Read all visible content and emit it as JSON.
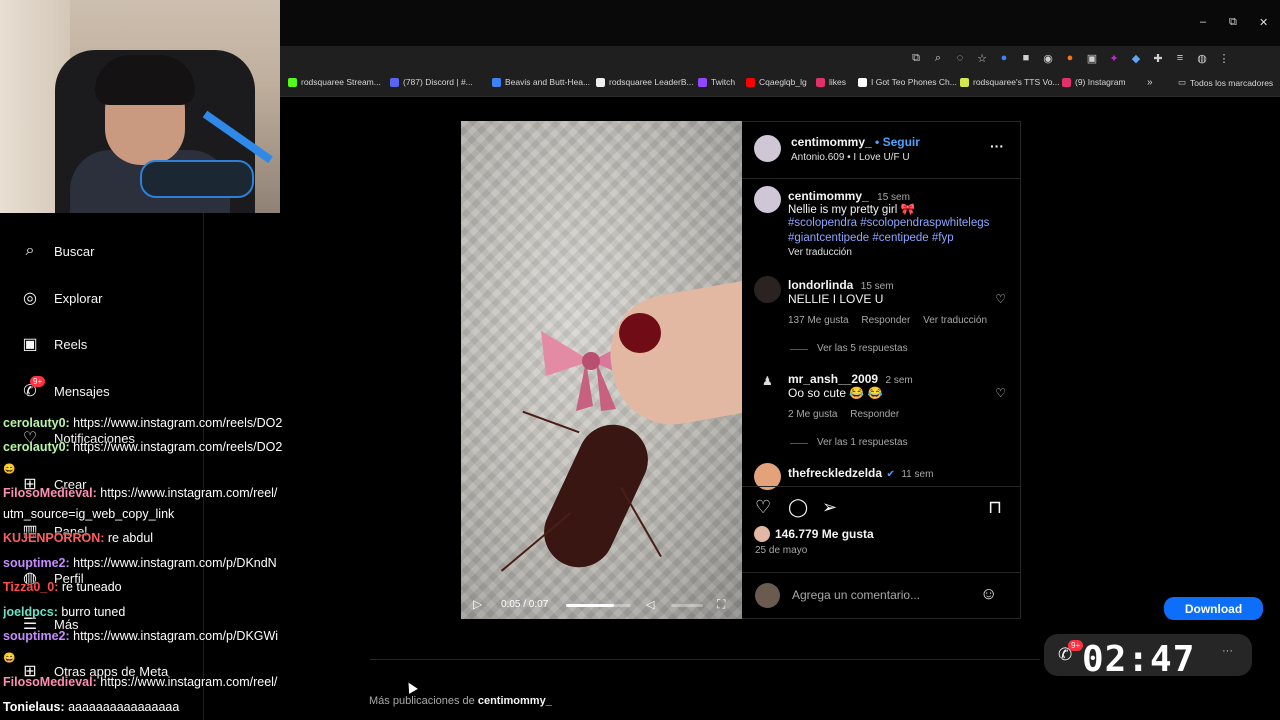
{
  "window": {
    "minimize": "–",
    "maximize": "⧉",
    "close": "✕"
  },
  "bookmarks": [
    {
      "label": "rodsquaree Stream...",
      "color": "#53fc18"
    },
    {
      "label": "(787) Discord | #...",
      "color": "#5865f2"
    },
    {
      "label": "Beavis and Butt-Hea...",
      "color": "#3b82f6"
    },
    {
      "label": "rodsquaree LeaderB...",
      "color": "#eeeeee"
    },
    {
      "label": "Twitch",
      "color": "#9146ff"
    },
    {
      "label": "Cqaeglqb_lg",
      "color": "#ff0000"
    },
    {
      "label": "likes",
      "color": "#e1306c"
    },
    {
      "label": "I Got Teo Phones Ch...",
      "color": "#ffffff"
    },
    {
      "label": "rodsquaree's TTS Vo...",
      "color": "#d7e84a"
    },
    {
      "label": "(9) Instagram",
      "color": "#e1306c"
    }
  ],
  "bookmarks_overflow": "»",
  "bookmarks_all": "Todos los marcadores",
  "nav": {
    "search": "Buscar",
    "explore": "Explorar",
    "reels": "Reels",
    "messages": "Mensajes",
    "messages_badge": "9+",
    "notifications": "Notificaciones",
    "create": "Crear",
    "panel": "Panel",
    "profile": "Perfil",
    "more": "Más",
    "meta": "Otras apps de Meta"
  },
  "chat": [
    {
      "user": "cerolauty0:",
      "msg": " https://www.instagram.com/reels/DO2",
      "color": "#b9f5a5"
    },
    {
      "user": "cerolauty0:",
      "msg": " https://www.instagram.com/reels/DO2",
      "color": "#b9f5a5"
    },
    {
      "user": "FilosoMedieval:",
      "msg": " https://www.instagram.com/reel/",
      "color": "#ff8fb1"
    },
    {
      "user": "",
      "msg": "utm_source=ig_web_copy_link",
      "color": "#ffffff"
    },
    {
      "user": "KUJENPORRON:",
      "msg": " re abdul",
      "color": "#ff5f5f"
    },
    {
      "user": "souptime2:",
      "msg": " https://www.instagram.com/p/DKndN",
      "color": "#c58cff"
    },
    {
      "user": "Tizza0_0:",
      "msg": " re tuneado",
      "color": "#ff4d4d"
    },
    {
      "user": "joeldpcs:",
      "msg": " burro tuned",
      "color": "#66e3c4"
    },
    {
      "user": "souptime2:",
      "msg": " https://www.instagram.com/p/DKGWi",
      "color": "#c58cff"
    },
    {
      "user": "FilosoMedieval:",
      "msg": " https://www.instagram.com/reel/",
      "color": "#ff8fb1"
    },
    {
      "user": "Tonielaus:",
      "msg": " aaaaaaaaaaaaaaaa",
      "color": "#ffffff"
    }
  ],
  "post": {
    "author": "centimommy_",
    "follow": "• Seguir",
    "audio": "Antonio.609 • I Love U/F U",
    "more": "···",
    "caption_time": "15 sem",
    "caption_text": "Nellie is my pretty girl 🎀",
    "hashtags_1": "#scolopendra #scolopendraspwhitelegs",
    "hashtags_2": "#giantcentipede #centipede #fyp",
    "see_translation": "Ver traducción",
    "comments": [
      {
        "user": "londorlinda",
        "time": "15 sem",
        "text": "NELLIE I LOVE U",
        "likes": "137 Me gusta",
        "reply": "Responder",
        "translate": "Ver traducción",
        "replies": "Ver las 5 respuestas"
      },
      {
        "user": "mr_ansh__2009",
        "time": "2 sem",
        "text": "Oo so cute 😂 😂",
        "likes": "2 Me gusta",
        "reply": "Responder",
        "translate": "",
        "replies": "Ver las 1 respuestas"
      },
      {
        "user": "thefreckledzelda",
        "time": "11 sem",
        "text": "",
        "likes": "",
        "reply": "",
        "translate": "",
        "replies": ""
      }
    ],
    "likes": "146.779 Me gusta",
    "date": "25 de mayo",
    "comment_placeholder": "Agrega un comentario...",
    "video_time": "0:05 / 0:07"
  },
  "download": "Download",
  "timer": "02:47",
  "timer_badge": "9+",
  "more_pubs_prefix": "Más publicaciones de ",
  "more_pubs_user": "centimommy_"
}
